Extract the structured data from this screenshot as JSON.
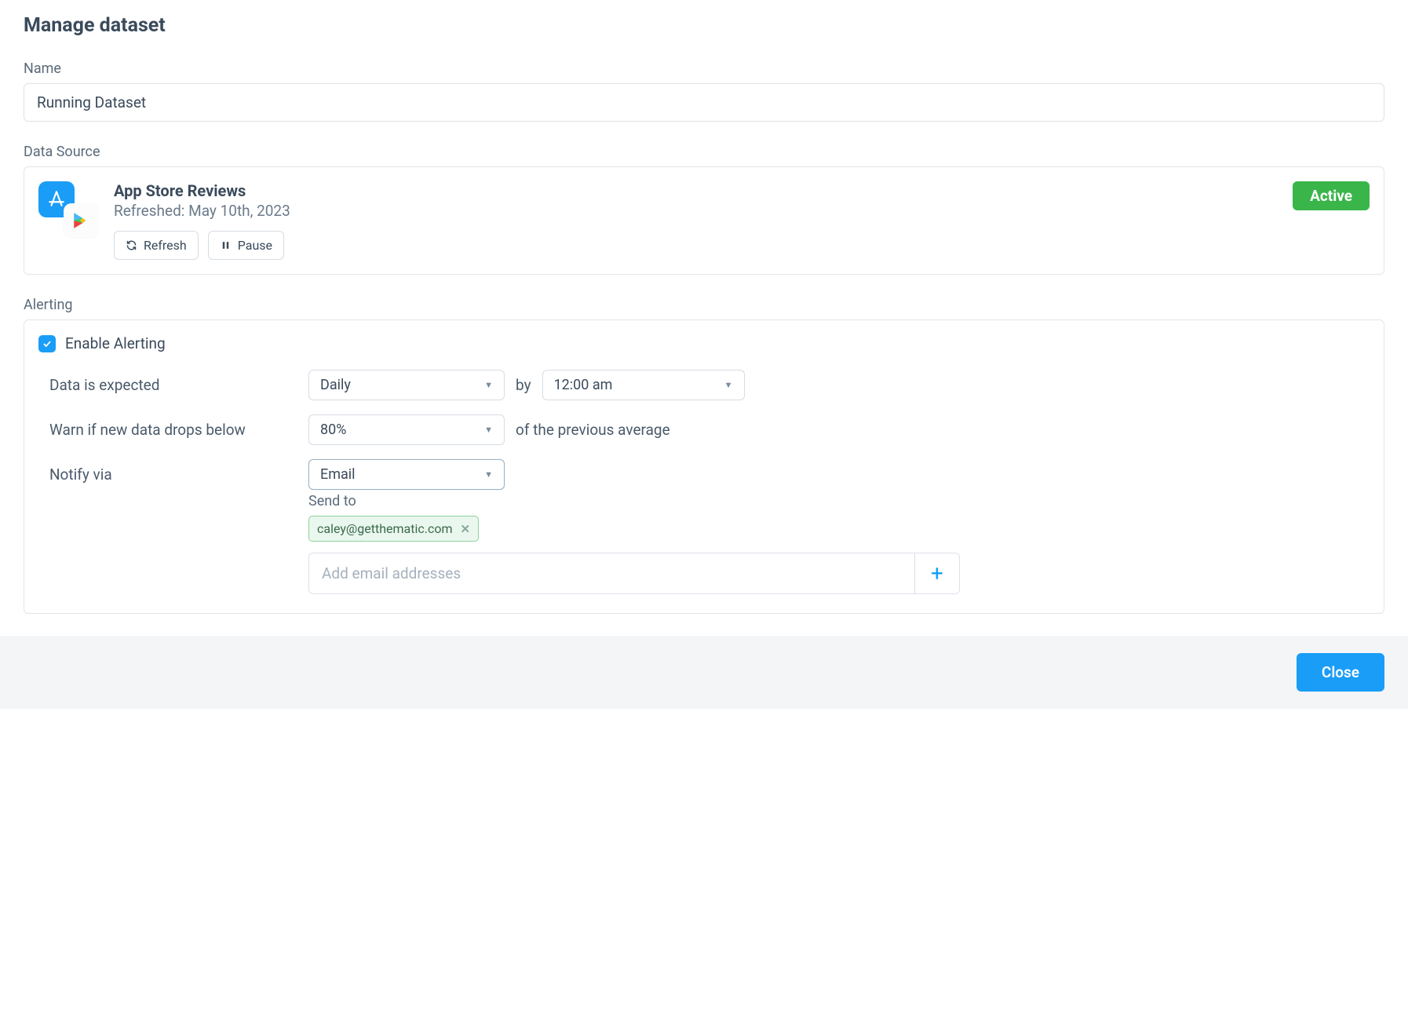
{
  "title": "Manage dataset",
  "name": {
    "label": "Name",
    "value": "Running Dataset"
  },
  "dataSource": {
    "label": "Data Source",
    "title": "App Store Reviews",
    "refreshed": "Refreshed: May 10th, 2023",
    "status": "Active",
    "refreshBtn": "Refresh",
    "pauseBtn": "Pause"
  },
  "alerting": {
    "label": "Alerting",
    "enableLabel": "Enable Alerting",
    "enabled": true,
    "expectedLabel": "Data is expected",
    "frequency": "Daily",
    "byLabel": "by",
    "byTime": "12:00 am",
    "warnLabel": "Warn if new data drops below",
    "threshold": "80%",
    "warnSuffix": "of the previous average",
    "notifyLabel": "Notify via",
    "notifyMethod": "Email",
    "sendToLabel": "Send to",
    "recipients": [
      "caley@getthematic.com"
    ],
    "emailPlaceholder": "Add email addresses"
  },
  "footer": {
    "close": "Close"
  }
}
